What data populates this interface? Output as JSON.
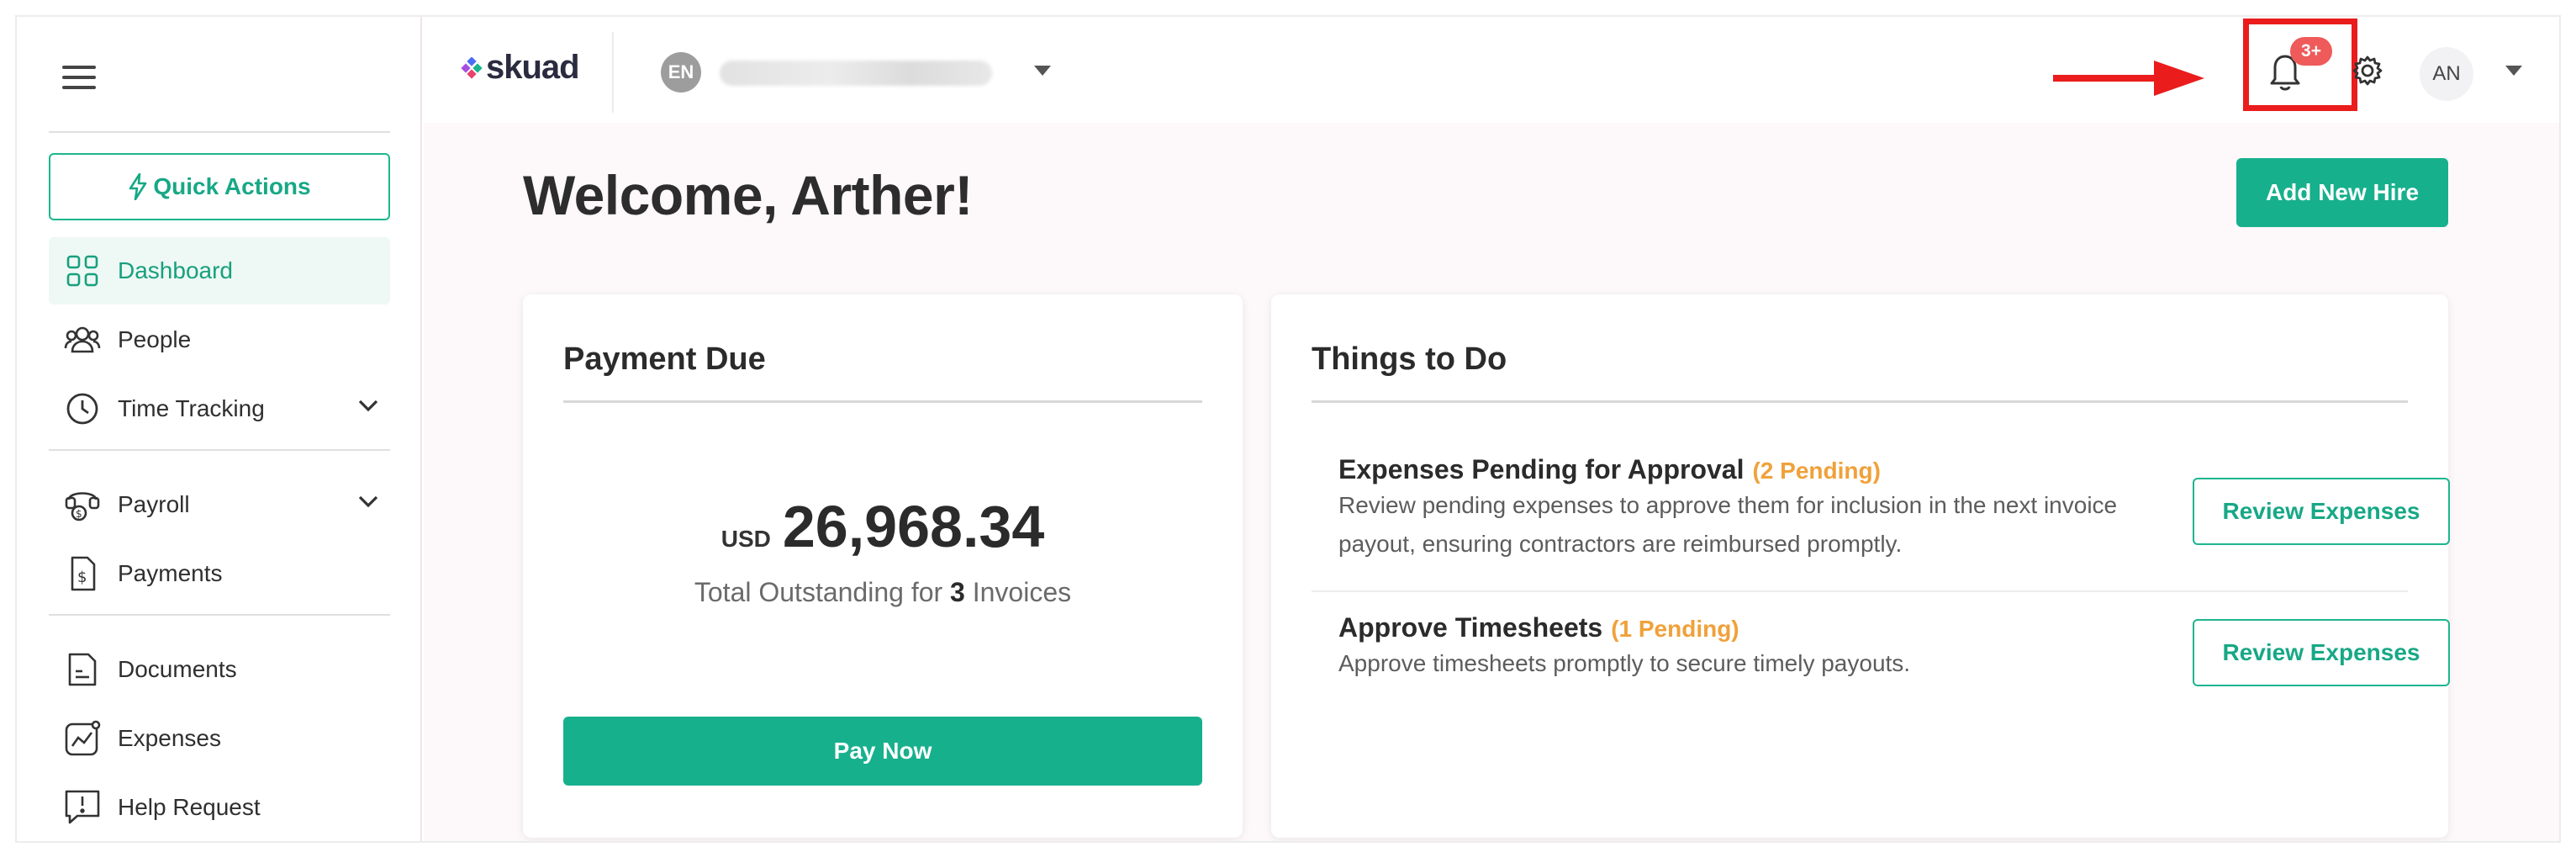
{
  "sidebar": {
    "quick_actions": "Quick Actions",
    "items": [
      {
        "label": "Dashboard",
        "icon": "grid-icon",
        "active": true
      },
      {
        "label": "People",
        "icon": "people-icon"
      },
      {
        "label": "Time Tracking",
        "icon": "clock-icon",
        "expandable": true
      },
      {
        "label": "Payroll",
        "icon": "payroll-icon",
        "expandable": true
      },
      {
        "label": "Payments",
        "icon": "payments-icon"
      },
      {
        "label": "Documents",
        "icon": "document-icon"
      },
      {
        "label": "Expenses",
        "icon": "expenses-icon"
      },
      {
        "label": "Help Request",
        "icon": "help-request-icon"
      }
    ]
  },
  "header": {
    "logo": "skuad",
    "org_initials": "EN",
    "notification_badge": "3+",
    "user_initials": "AN"
  },
  "main": {
    "welcome": "Welcome, Arther!",
    "add_new_hire": "Add New Hire",
    "payment": {
      "title": "Payment Due",
      "currency": "USD",
      "amount": "26,968.34",
      "outstanding_prefix": "Total Outstanding for",
      "invoice_count": "3",
      "outstanding_suffix": "Invoices",
      "pay_now": "Pay Now"
    },
    "todo": {
      "title": "Things to Do",
      "tasks": [
        {
          "title": "Expenses Pending for Approval",
          "pending": "(2 Pending)",
          "description": "Review pending expenses to approve them for inclusion in the next invoice payout, ensuring contractors are reimbursed promptly.",
          "button": "Review Expenses"
        },
        {
          "title": "Approve Timesheets",
          "pending": "(1 Pending)",
          "description": "Approve timesheets promptly to secure timely payouts.",
          "button": "Review Expenses"
        }
      ]
    }
  },
  "colors": {
    "brand_green": "#17b08d",
    "pending_orange": "#f0a13a",
    "badge_red": "#ef5a5a",
    "annotation_red": "#ea1c1c"
  }
}
